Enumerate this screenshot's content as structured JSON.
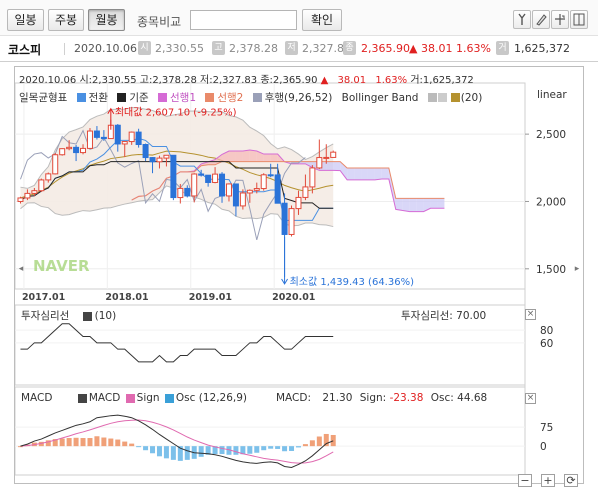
{
  "toolbar": {
    "period_buttons": [
      "일봉",
      "주봉",
      "월봉"
    ],
    "active_period": 2,
    "compare_label": "종목비교",
    "compare_value": "",
    "confirm_label": "확인"
  },
  "quote": {
    "name": "코스피",
    "date": "2020.10.06",
    "open_tag": "시",
    "open": "2,330.55",
    "high_tag": "고",
    "high": "2,378.28",
    "low_tag": "저",
    "low": "2,327.83",
    "close_tag": "종",
    "close": "2,365.90",
    "change_arrow": "▲",
    "change": "38.01",
    "change_pct": "1.63%",
    "volume_tag": "거",
    "volume": "1,625,372"
  },
  "status_line": {
    "date": "2020.10.06",
    "open": "시:2,330.55",
    "high": "고:2,378.28",
    "low": "저:2,327.83",
    "close": "종:2,365.90",
    "arrow": "▲",
    "change": "38.01",
    "change_pct": "1.63%",
    "volume": "거:1,625,372"
  },
  "legend": {
    "indicator": "일목균형표",
    "items": [
      {
        "label": "전환",
        "color": "#4a90e2"
      },
      {
        "label": "기준",
        "color": "#222222"
      },
      {
        "label": "선행1",
        "color": "#d56bd5"
      },
      {
        "label": "선행2",
        "color": "#e98a6a"
      },
      {
        "label": "후행(9,26,52)",
        "color": "#9aa0b8"
      },
      {
        "label": "Bollinger Band",
        "color": "#cfcfcf"
      },
      {
        "label": "(20)",
        "color": "#b5922f"
      }
    ],
    "scale": "linear"
  },
  "annotations": {
    "max_label": "최대값 2,607.10 (-9.25%)",
    "min_label": "최소값 1,439.43 (64.36%)",
    "watermark": "NAVER"
  },
  "panels": {
    "investor": {
      "title": "투자심리선",
      "param": "(10)",
      "value_label": "투자심리선: 70.00",
      "ticks": [
        "80",
        "60"
      ]
    },
    "macd": {
      "title": "MACD",
      "legend": [
        "MACD",
        "Sign",
        "Osc (12,26,9)"
      ],
      "legend_colors": [
        "#444444",
        "#e06ab0",
        "#3aa0d8"
      ],
      "values_label": "MACD: ",
      "macd_value": "21.30",
      "sign_label": "Sign:",
      "sign_value": "-23.38",
      "osc_label": "Osc:",
      "osc_value": "44.68",
      "ticks": [
        "75",
        "0"
      ]
    }
  },
  "chart_data": [
    {
      "type": "candlestick",
      "title": "코스피 월봉",
      "x_tick_labels": [
        "2017.01",
        "2018.01",
        "2019.01",
        "2020.01"
      ],
      "y_ticks": [
        2500,
        2000,
        1500
      ],
      "ylim": [
        1350,
        2850
      ],
      "scale": "linear",
      "months": 46,
      "start": "2016.12",
      "candles_ohlc": [
        [
          2000,
          2035,
          1985,
          2026
        ],
        [
          2026,
          2090,
          2010,
          2060
        ],
        [
          2060,
          2100,
          2040,
          2080
        ],
        [
          2080,
          2170,
          2070,
          2160
        ],
        [
          2160,
          2215,
          2140,
          2205
        ],
        [
          2205,
          2360,
          2200,
          2347
        ],
        [
          2347,
          2395,
          2340,
          2392
        ],
        [
          2392,
          2455,
          2380,
          2402
        ],
        [
          2402,
          2420,
          2300,
          2363
        ],
        [
          2363,
          2425,
          2350,
          2394
        ],
        [
          2394,
          2545,
          2390,
          2523
        ],
        [
          2523,
          2560,
          2460,
          2476
        ],
        [
          2476,
          2530,
          2450,
          2467
        ],
        [
          2467,
          2607,
          2480,
          2566
        ],
        [
          2566,
          2575,
          2370,
          2427
        ],
        [
          2427,
          2440,
          2330,
          2445
        ],
        [
          2445,
          2520,
          2420,
          2515
        ],
        [
          2515,
          2540,
          2400,
          2423
        ],
        [
          2423,
          2430,
          2300,
          2326
        ],
        [
          2326,
          2330,
          2210,
          2295
        ],
        [
          2295,
          2340,
          2245,
          2322
        ],
        [
          2322,
          2345,
          2260,
          2343
        ],
        [
          2343,
          2340,
          2010,
          2029
        ],
        [
          2029,
          2130,
          1985,
          2097
        ],
        [
          2097,
          2120,
          2030,
          2041
        ],
        [
          2041,
          2210,
          1993,
          2204
        ],
        [
          2204,
          2235,
          2185,
          2195
        ],
        [
          2195,
          2185,
          2110,
          2141
        ],
        [
          2141,
          2255,
          2135,
          2203
        ],
        [
          2203,
          2218,
          1990,
          2041
        ],
        [
          2041,
          2135,
          2000,
          2130
        ],
        [
          2130,
          2090,
          1890,
          1967
        ],
        [
          1967,
          2090,
          1940,
          2063
        ],
        [
          2063,
          2090,
          1990,
          2083
        ],
        [
          2083,
          2140,
          2060,
          2096
        ],
        [
          2096,
          2210,
          2080,
          2198
        ],
        [
          2198,
          2280,
          2180,
          2197
        ],
        [
          2197,
          2280,
          2000,
          1987
        ],
        [
          1987,
          2060,
          1439,
          1755
        ],
        [
          1755,
          1970,
          1740,
          1947
        ],
        [
          1947,
          2080,
          1900,
          2030
        ],
        [
          2030,
          2200,
          2010,
          2108
        ],
        [
          2108,
          2270,
          2060,
          2249
        ],
        [
          2249,
          2460,
          2240,
          2326
        ],
        [
          2326,
          2425,
          2280,
          2327
        ],
        [
          2327,
          2378,
          2327,
          2366
        ]
      ],
      "max": {
        "value": 2607.1,
        "date": "2018.01"
      },
      "min": {
        "value": 1439.43,
        "date": "2020.03"
      }
    },
    {
      "type": "line",
      "title": "투자심리선 (10)",
      "ylim": [
        0,
        110
      ],
      "y_ticks": [
        80,
        60
      ],
      "values": [
        50,
        50,
        60,
        60,
        70,
        80,
        90,
        90,
        80,
        70,
        70,
        60,
        60,
        60,
        50,
        50,
        40,
        30,
        30,
        30,
        40,
        30,
        30,
        40,
        40,
        50,
        50,
        50,
        50,
        40,
        40,
        40,
        50,
        60,
        60,
        70,
        70,
        60,
        50,
        50,
        60,
        70,
        70,
        70,
        70,
        70
      ]
    },
    {
      "type": "bar+line",
      "title": "MACD (12,26,9)",
      "ylim": [
        -90,
        170
      ],
      "y_ticks": [
        75,
        0
      ],
      "macd": [
        0,
        8,
        20,
        28,
        40,
        52,
        62,
        72,
        82,
        88,
        96,
        112,
        116,
        120,
        122,
        118,
        112,
        100,
        84,
        66,
        46,
        28,
        10,
        -8,
        -18,
        -26,
        -28,
        -30,
        -34,
        -40,
        -48,
        -56,
        -62,
        -66,
        -68,
        -64,
        -62,
        -66,
        -80,
        -84,
        -72,
        -58,
        -38,
        -14,
        10,
        21
      ],
      "sign": [
        0,
        2,
        6,
        11,
        17,
        24,
        32,
        40,
        49,
        56,
        64,
        73,
        82,
        90,
        96,
        100,
        102,
        103,
        100,
        94,
        86,
        76,
        64,
        50,
        36,
        24,
        14,
        4,
        -3,
        -9,
        -14,
        -22,
        -30,
        -36,
        -42,
        -48,
        -52,
        -55,
        -60,
        -65,
        -67,
        -66,
        -61,
        -52,
        -38,
        -23
      ],
      "osc": [
        0,
        6,
        14,
        17,
        23,
        28,
        30,
        32,
        33,
        32,
        32,
        39,
        34,
        30,
        26,
        18,
        10,
        -3,
        -16,
        -28,
        -40,
        -48,
        -54,
        -58,
        -54,
        -50,
        -42,
        -34,
        -31,
        -31,
        -34,
        -34,
        -32,
        -30,
        -26,
        -16,
        -10,
        -11,
        -20,
        -19,
        -5,
        8,
        23,
        38,
        48,
        44
      ]
    }
  ]
}
